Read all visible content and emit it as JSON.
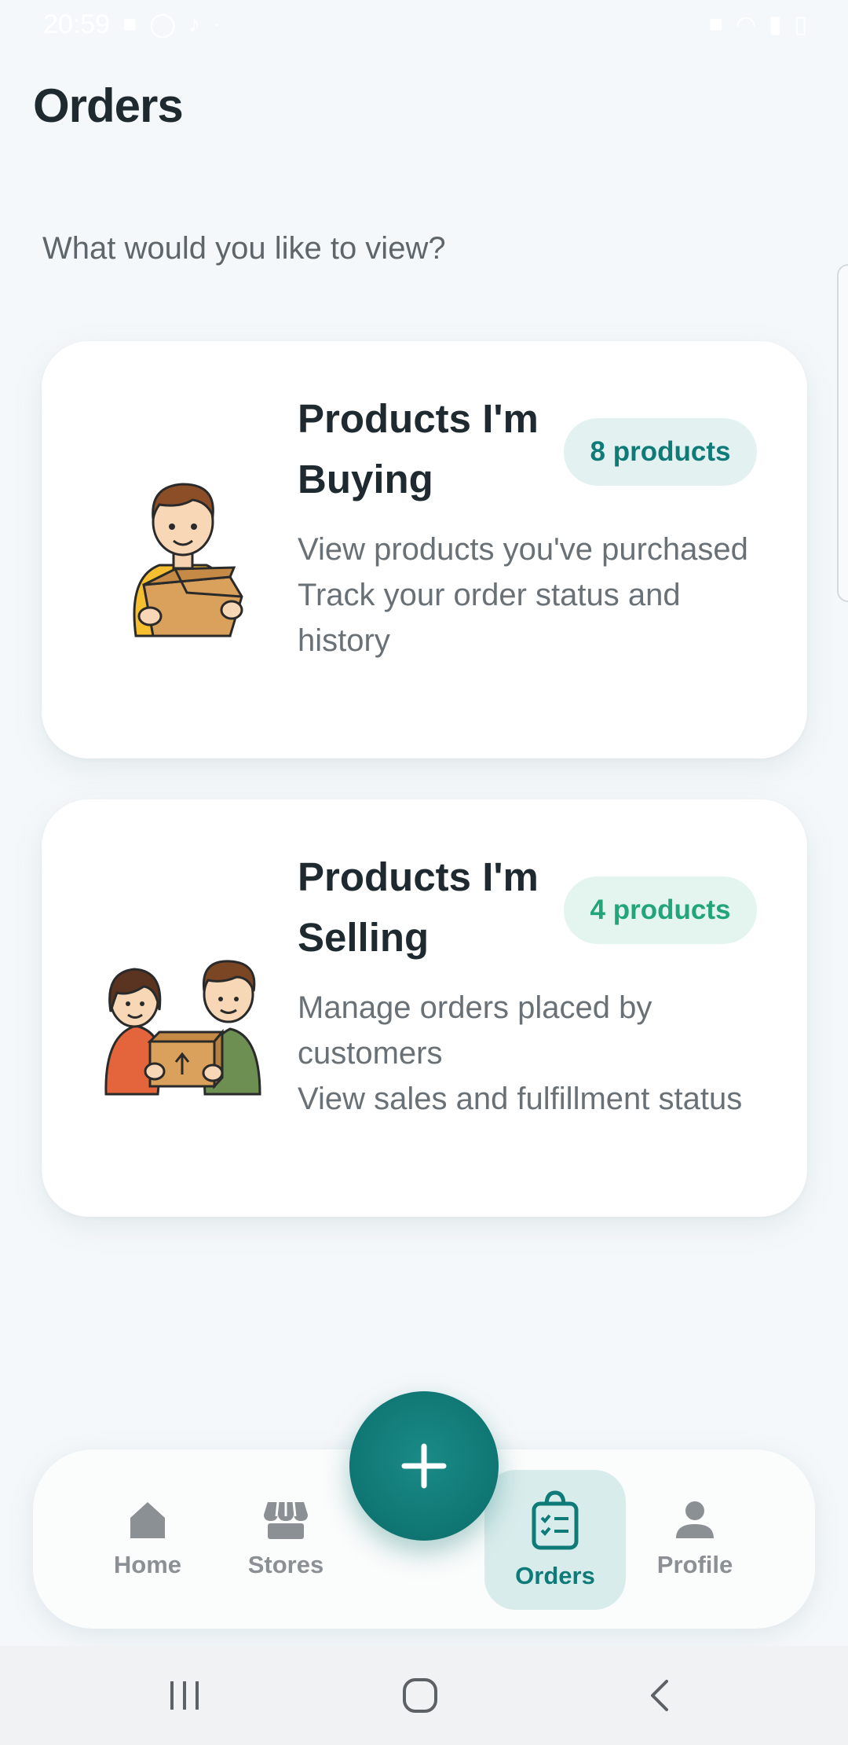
{
  "status_bar": {
    "time": "20:59",
    "left_icons": [
      "video-call-icon",
      "whatsapp-icon",
      "tiktok-icon",
      "dot-icon"
    ],
    "right_icons": [
      "mute-icon",
      "wifi-icon",
      "signal-icon",
      "battery-icon"
    ]
  },
  "header": {
    "title": "Orders"
  },
  "prompt": "What would you like to view?",
  "cards": [
    {
      "title": "Products I'm Buying",
      "badge": "8 products",
      "badge_color": "#0f7b78",
      "description_lines": [
        "View products you've purchased",
        "Track your order status and history"
      ],
      "illustration": "person-holding-box"
    },
    {
      "title": "Products I'm Selling",
      "badge": "4 products",
      "badge_color": "#22a57a",
      "description_lines": [
        "Manage orders placed by customers",
        "View sales and fulfillment status"
      ],
      "illustration": "two-people-exchanging-box"
    }
  ],
  "bottom_nav": {
    "items": [
      {
        "label": "Home",
        "icon": "home-icon",
        "active": false
      },
      {
        "label": "Stores",
        "icon": "store-icon",
        "active": false
      },
      {
        "label": "Orders",
        "icon": "shopping-bag-list-icon",
        "active": true
      },
      {
        "label": "Profile",
        "icon": "person-icon",
        "active": false
      }
    ],
    "fab_icon": "plus-icon"
  },
  "system_nav": {
    "buttons": [
      "recent-apps-icon",
      "home-circle-icon",
      "back-icon"
    ]
  },
  "colors": {
    "accent": "#0f7b78",
    "background": "#f5f8fa",
    "card": "#ffffff",
    "inactive_nav": "#8b9094"
  }
}
